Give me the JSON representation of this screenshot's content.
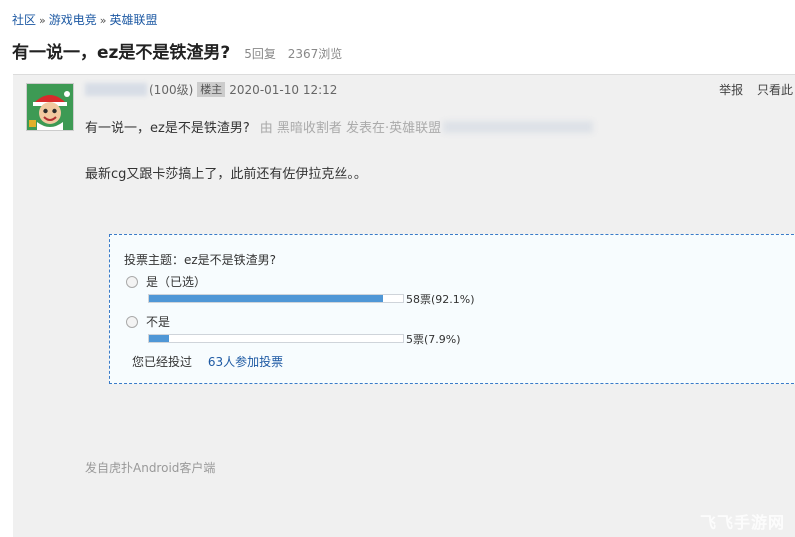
{
  "breadcrumb": {
    "items": [
      "社区",
      "游戏电竞",
      "英雄联盟"
    ],
    "separator": "»"
  },
  "thread": {
    "title": "有一说一，ez是不是铁渣男?",
    "replies": "5回复",
    "views": "2367浏览"
  },
  "post": {
    "level": "(100级)",
    "owner_badge": "楼主",
    "time": "2020-01-10 12:12",
    "actions": {
      "report": "举报",
      "only_this": "只看此"
    },
    "subject": "有一说一，ez是不是铁渣男?",
    "sub_note": "由 黑暗收割者 发表在·英雄联盟",
    "body": "最新cg又跟卡莎搞上了，此前还有佐伊拉克丝。。",
    "client": "发自虎扑Android客户端"
  },
  "vote": {
    "title": "投票主题：ez是不是铁渣男?",
    "options": [
      {
        "label": "是（已选）",
        "fraction": 0.921,
        "result": "58票(92.1%)"
      },
      {
        "label": "不是",
        "fraction": 0.079,
        "result": "5票(7.9%)"
      }
    ],
    "voted_text": "您已经投过",
    "participants": "63人参加投票"
  },
  "colors": {
    "link": "#1d59a3",
    "bar": "#4f97d6",
    "vote_border": "#3a7bc8"
  },
  "watermark": "飞飞手游网"
}
